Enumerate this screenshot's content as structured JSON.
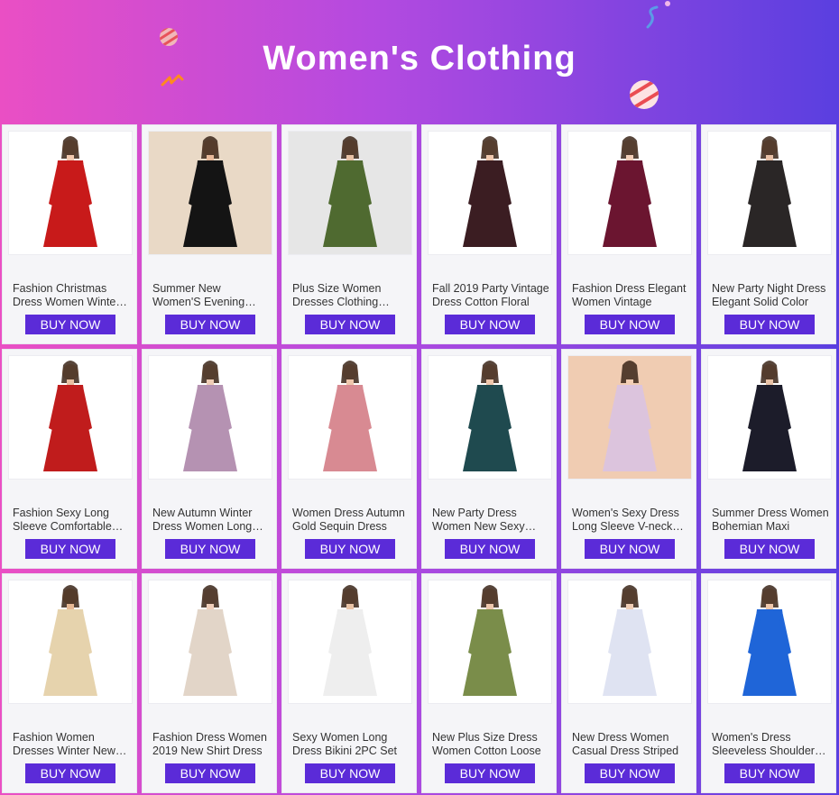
{
  "header": {
    "title": "Women's Clothing"
  },
  "colors": {
    "button": "#5b2bd8",
    "header_start": "#ea4fc4",
    "header_end": "#5a3fe0"
  },
  "products": [
    {
      "name": "Fashion Christmas Dress Women Winter Dress",
      "button": "BUY NOW",
      "image": "red-christmas-dress",
      "bg": "#ffffff",
      "dress": "#c81a1a",
      "skin": "#f1c9b0"
    },
    {
      "name": "Summer New Women'S Evening Dress",
      "button": "BUY NOW",
      "image": "black-lace-dress",
      "bg": "#e9d9c6",
      "dress": "#141414",
      "skin": "#e7b99a"
    },
    {
      "name": "Plus Size Women Dresses Clothing Autumn",
      "button": "BUY NOW",
      "image": "green-tunic-dress",
      "bg": "#e6e6e6",
      "dress": "#4f6a30",
      "skin": "#e7c1a6"
    },
    {
      "name": "Fall 2019 Party Vintage Dress Cotton Floral",
      "button": "BUY NOW",
      "image": "floral-maxi-dress",
      "bg": "#ffffff",
      "dress": "#3b1d22",
      "skin": "#efc8ae"
    },
    {
      "name": "Fashion Dress Elegant Women Vintage",
      "button": "BUY NOW",
      "image": "burgundy-floral-dress",
      "bg": "#ffffff",
      "dress": "#6b1530",
      "skin": "#f2cfb9"
    },
    {
      "name": "New Party Night Dress Elegant Solid Color",
      "button": "BUY NOW",
      "image": "black-mermaid-dress",
      "bg": "#ffffff",
      "dress": "#2a2626",
      "skin": "#e8c0a6"
    },
    {
      "name": "Fashion Sexy Long Sleeve Comfortable Dress",
      "button": "BUY NOW",
      "image": "red-bodycon-dress",
      "bg": "#ffffff",
      "dress": "#c01c1c",
      "skin": "#e9c0a3"
    },
    {
      "name": "New Autumn Winter Dress Women Long Sleeve",
      "button": "BUY NOW",
      "image": "mauve-knit-dress",
      "bg": "#ffffff",
      "dress": "#b592b2",
      "skin": "#efcdb6"
    },
    {
      "name": "Women Dress Autumn Gold Sequin Dress",
      "button": "BUY NOW",
      "image": "pink-sequin-dress",
      "bg": "#ffffff",
      "dress": "#d88a92",
      "skin": "#efc7ad"
    },
    {
      "name": "New Party Dress Women New Sexy Floral",
      "button": "BUY NOW",
      "image": "teal-floral-maxi",
      "bg": "#ffffff",
      "dress": "#1f4a4f",
      "skin": "#efc8ad"
    },
    {
      "name": "Women's Sexy Dress Long Sleeve V-neck Dress",
      "button": "BUY NOW",
      "image": "lilac-peplum-dress",
      "bg": "#f0ccb2",
      "dress": "#dcc4dd",
      "skin": "#f2ceb4"
    },
    {
      "name": "Summer Dress Women Bohemian Maxi",
      "button": "BUY NOW",
      "image": "boho-off-shoulder-dress",
      "bg": "#ffffff",
      "dress": "#1c1c2a",
      "skin": "#e9c3a8"
    },
    {
      "name": "Fashion Women Dresses Winter New Dress",
      "button": "BUY NOW",
      "image": "cream-wrap-dress",
      "bg": "#ffffff",
      "dress": "#e6d3ad",
      "skin": "#e6b894"
    },
    {
      "name": "Fashion Dress Women 2019 New Shirt Dress",
      "button": "BUY NOW",
      "image": "beige-shirt-dress",
      "bg": "#ffffff",
      "dress": "#e2d5c8",
      "skin": "#f0cfbb"
    },
    {
      "name": "Sexy Women Long Dress Bikini 2PC Set",
      "button": "BUY NOW",
      "image": "white-lace-coverup",
      "bg": "#ffffff",
      "dress": "#eeeeee",
      "skin": "#e9c3a6"
    },
    {
      "name": "New Plus Size Dress Women Cotton Loose",
      "button": "BUY NOW",
      "image": "olive-tunic-dress",
      "bg": "#ffffff",
      "dress": "#7a8d4a",
      "skin": "#eec8ae"
    },
    {
      "name": "New Dress Women Casual Dress Striped",
      "button": "BUY NOW",
      "image": "striped-bell-sleeve-dress",
      "bg": "#ffffff",
      "dress": "#dfe3f2",
      "skin": "#f0cdb5"
    },
    {
      "name": "Women's Dress Sleeveless Shoulder Maternity",
      "button": "BUY NOW",
      "image": "blue-maternity-dress",
      "bg": "#ffffff",
      "dress": "#1f65d8",
      "skin": "#efc8ad"
    }
  ]
}
